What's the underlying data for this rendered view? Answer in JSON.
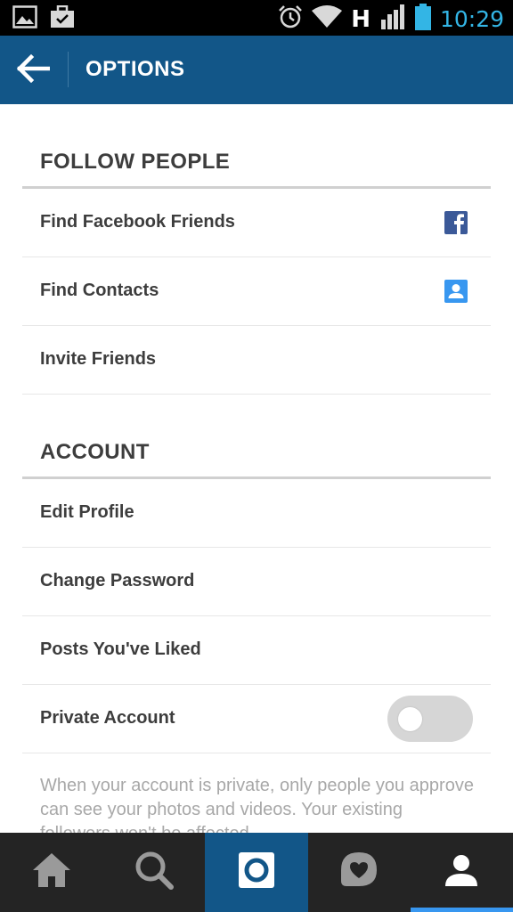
{
  "status_bar": {
    "time": "10:29",
    "network": "H",
    "icons": [
      "gallery-icon",
      "briefcase-icon",
      "alarm-icon",
      "wifi-icon",
      "signal-icon",
      "battery-icon"
    ]
  },
  "header": {
    "title": "OPTIONS",
    "back_icon": "back-arrow-icon"
  },
  "sections": {
    "follow_people": {
      "title": "FOLLOW PEOPLE",
      "items": [
        {
          "label": "Find Facebook Friends",
          "icon": "facebook-icon"
        },
        {
          "label": "Find Contacts",
          "icon": "contacts-icon"
        },
        {
          "label": "Invite Friends"
        }
      ]
    },
    "account": {
      "title": "ACCOUNT",
      "items": [
        {
          "label": "Edit Profile"
        },
        {
          "label": "Change Password"
        },
        {
          "label": "Posts You've Liked"
        },
        {
          "label": "Private Account",
          "toggle": false
        }
      ],
      "note": "When your account is private, only people you approve can see your photos and videos. Your existing followers won't be affected."
    }
  },
  "tab_bar": {
    "tabs": [
      "home-icon",
      "search-icon",
      "camera-icon",
      "activity-icon",
      "profile-icon"
    ],
    "active": "profile-icon"
  },
  "colors": {
    "header": "#125688",
    "accent": "#3897f0",
    "facebook": "#3b5998",
    "contacts": "#3897f0",
    "status_time": "#33b5e5"
  }
}
